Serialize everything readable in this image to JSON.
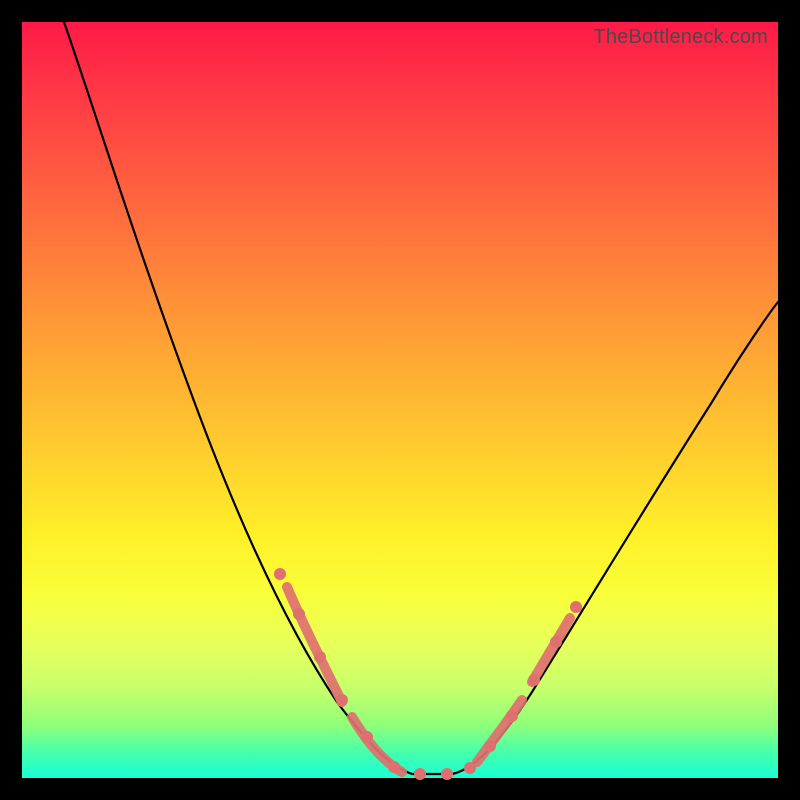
{
  "watermark": "TheBottleneck.com",
  "chart_data": {
    "type": "line",
    "title": "",
    "xlabel": "",
    "ylabel": "",
    "xlim": [
      0,
      100
    ],
    "ylim": [
      0,
      100
    ],
    "grid": false,
    "legend": false,
    "series": [
      {
        "name": "bottleneck-curve",
        "x": [
          5,
          10,
          15,
          20,
          25,
          30,
          35,
          40,
          45,
          48,
          50,
          52,
          55,
          58,
          62,
          68,
          75,
          82,
          90,
          100
        ],
        "y": [
          100,
          90,
          79,
          67,
          55,
          44,
          33,
          23,
          12,
          6,
          2,
          0,
          0,
          2,
          7,
          15,
          25,
          36,
          48,
          63
        ]
      }
    ],
    "highlight_segments": [
      {
        "side": "left",
        "x_range": [
          33,
          49
        ],
        "note": "salmon dotted overlay on descending branch"
      },
      {
        "side": "right",
        "x_range": [
          56,
          66
        ],
        "note": "salmon dotted overlay on ascending branch"
      }
    ],
    "annotations": []
  },
  "colors": {
    "gradient_top": "#ff1a47",
    "gradient_mid": "#ffd030",
    "gradient_bottom": "#1affd6",
    "curve": "#000000",
    "marker": "#e07070",
    "frame": "#000000"
  }
}
